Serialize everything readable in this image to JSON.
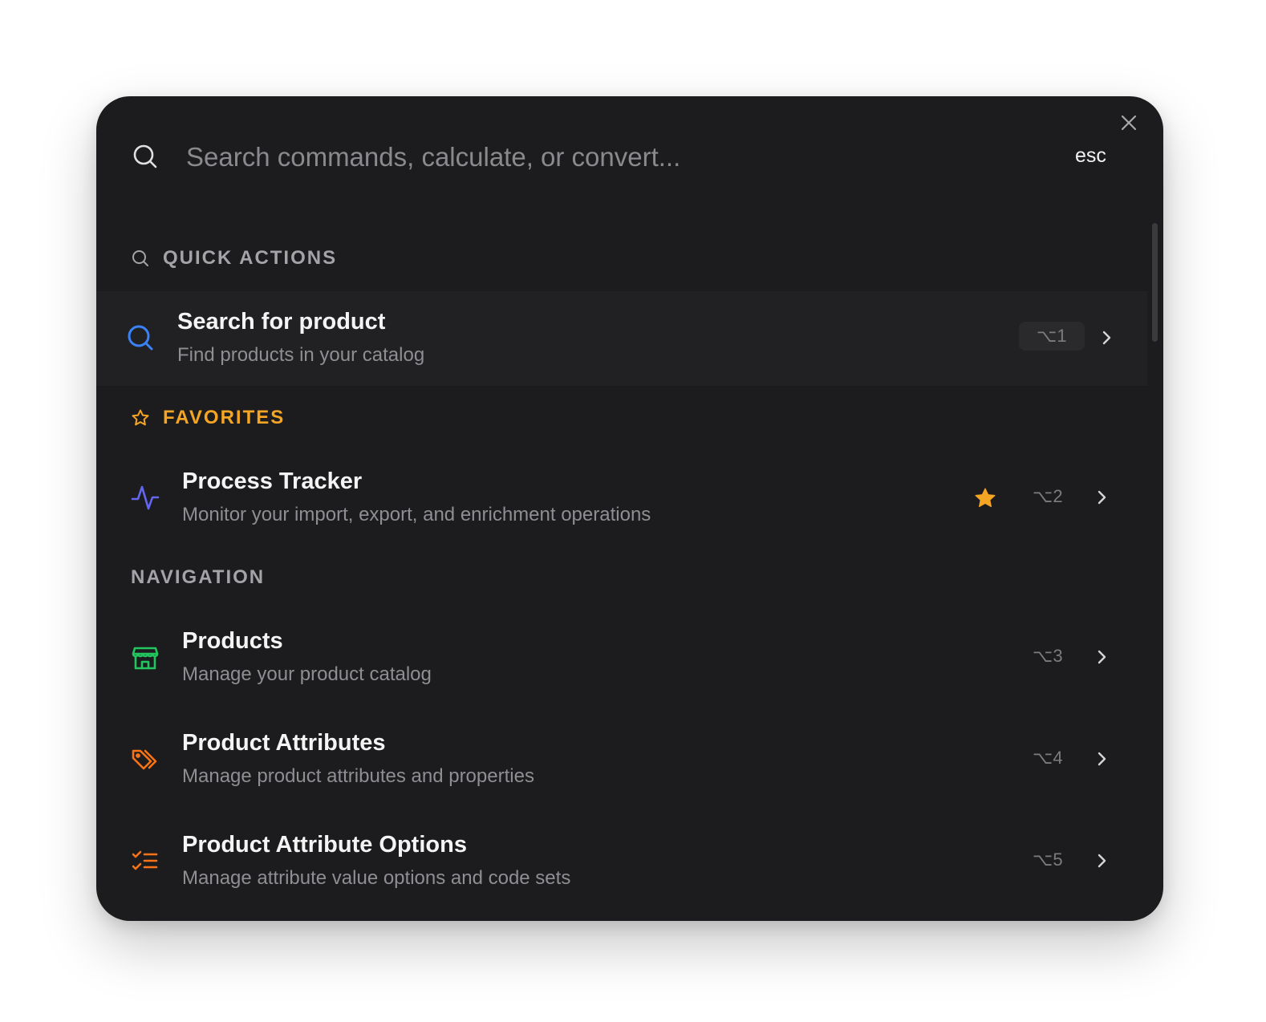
{
  "search": {
    "placeholder": "Search commands, calculate, or convert...",
    "value": "",
    "esc_label": "esc"
  },
  "sections": {
    "quick_actions": {
      "label": "QUICK ACTIONS",
      "items": [
        {
          "title": "Search for product",
          "subtitle": "Find products in your catalog",
          "shortcut": "⌥1",
          "icon": "search-icon",
          "color": "#3b82f6"
        }
      ]
    },
    "favorites": {
      "label": "FAVORITES",
      "color": "#f5a524",
      "items": [
        {
          "title": "Process Tracker",
          "subtitle": "Monitor your import, export, and enrichment operations",
          "shortcut": "⌥2",
          "icon": "activity-icon",
          "color": "#6366f1",
          "favorited": true
        }
      ]
    },
    "navigation": {
      "label": "NAVIGATION",
      "items": [
        {
          "title": "Products",
          "subtitle": "Manage your product catalog",
          "shortcut": "⌥3",
          "icon": "store-icon",
          "color": "#22c55e"
        },
        {
          "title": "Product Attributes",
          "subtitle": "Manage product attributes and properties",
          "shortcut": "⌥4",
          "icon": "tags-icon",
          "color": "#f97316"
        },
        {
          "title": "Product Attribute Options",
          "subtitle": "Manage attribute value options and code sets",
          "shortcut": "⌥5",
          "icon": "list-checks-icon",
          "color": "#f97316"
        }
      ]
    }
  }
}
